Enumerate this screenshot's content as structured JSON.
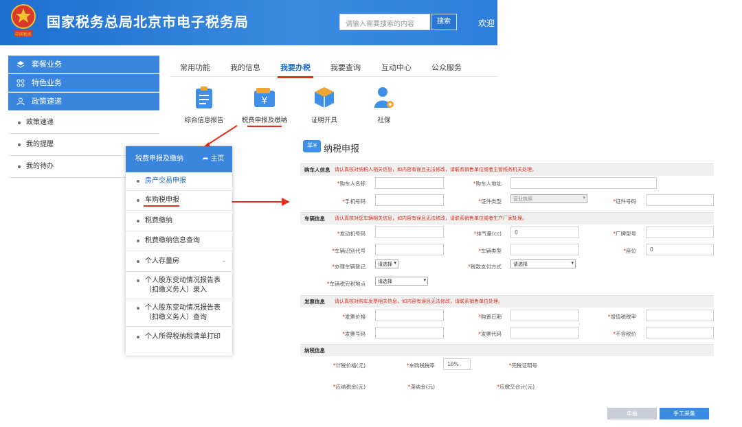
{
  "header": {
    "title": "国家税务总局北京市电子税务局",
    "search_placeholder": "请输入需要搜索的内容",
    "search_button": "搜索",
    "welcome": "欢迎"
  },
  "sidebar": {
    "sections": [
      {
        "label": "套餐业务",
        "icon": "layers-icon"
      },
      {
        "label": "特色业务",
        "icon": "grid-icon"
      },
      {
        "label": "政策速递",
        "icon": "user-icon"
      }
    ],
    "items": [
      "政策速递",
      "我的提醒",
      "我的待办"
    ]
  },
  "nav": {
    "tabs": [
      "常用功能",
      "我的信息",
      "我要办税",
      "我要查询",
      "互动中心",
      "公众服务"
    ],
    "active_tab": "我要办税"
  },
  "functions": [
    {
      "label": "综合信息报告",
      "icon": "clipboard-icon"
    },
    {
      "label": "税费申报及缴纳",
      "icon": "yuan-wallet-icon"
    },
    {
      "label": "证明开具",
      "icon": "cube-icon"
    },
    {
      "label": "社保",
      "icon": "user-gear-icon"
    }
  ],
  "submenu": {
    "title": "税费申报及缴纳",
    "home": "主页",
    "items": [
      {
        "label": "房产交易申报",
        "active": true
      },
      {
        "label": "车购税申报",
        "active": false
      },
      {
        "label": "税费缴纳",
        "active": false
      },
      {
        "label": "税费缴纳信息查询",
        "active": false
      },
      {
        "label": "个人存量房",
        "active": false
      },
      {
        "label": "个人股东变动情况报告表（扣缴义务人）录入",
        "active": false
      },
      {
        "label": "个人股东变动情况报告表（扣缴义务人）查询",
        "active": false
      },
      {
        "label": "个人所得税纳税清单打印",
        "active": false
      }
    ]
  },
  "form": {
    "title": "纳税申报",
    "title_badge": "羊¥",
    "sections": {
      "buyer": {
        "label": "购车人信息",
        "note": "请认真核对纳税人相关信息，如内容有误且无法修改，请联系销售单位或者主管税务机关处理。",
        "fields": {
          "name": "购车人名称",
          "address": "购车人地址",
          "phone": "手机号码",
          "id_type": "证件类型",
          "id_type_value": "营业执照",
          "id_no": "证件号码"
        }
      },
      "vehicle": {
        "label": "车辆信息",
        "note": "请认真核对您车辆相关信息，如内容有误且无法修改，请联系销售单位或者生产厂家处理。",
        "fields": {
          "engine": "发动机号码",
          "displacement": "排气量(cc)",
          "displacement_value": "0",
          "model": "厂牌型号",
          "vin": "车辆识别代号",
          "type": "车辆类型",
          "seats": "座位",
          "seats_value": "0",
          "register": "办理车辆登记",
          "register_value": "请选择",
          "payment": "税款支付方式",
          "payment_value": "请选择",
          "location": "车辆税完税地点",
          "location_value": "请选择"
        }
      },
      "invoice": {
        "label": "发票信息",
        "note": "请认真核对购车发票相关信息，如内容有误且无法修改，请联系销售单位处理。",
        "fields": {
          "price": "发票价格",
          "date": "购置日期",
          "vat_rate": "增值税税率",
          "number": "发票号码",
          "code": "发票代码",
          "ex_tax": "不含税价"
        }
      },
      "tax": {
        "label": "纳税信息",
        "fields": {
          "taxable_price": "计税价格(元)",
          "rate": "车购税税率",
          "rate_value": "10%",
          "certificate": "完税证明号",
          "payable": "应纳税金(元)",
          "late_fee": "滞纳金(元)",
          "total": "应缴交合计(元)"
        }
      }
    },
    "buttons": {
      "declare": "申报",
      "manual": "手工采集"
    }
  },
  "colors": {
    "header_blue": "#2e7fdc",
    "accent_red": "#e0301e",
    "active_blue": "#1d6fd6"
  }
}
